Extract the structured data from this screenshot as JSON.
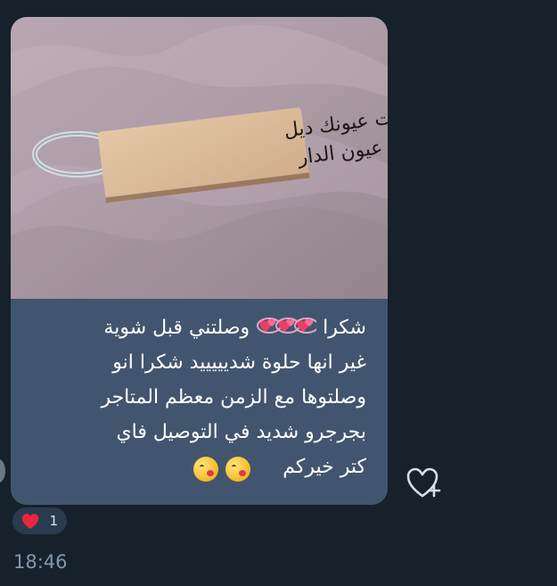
{
  "message": {
    "photo_text": {
      "line_1": "ولما لقيت عيونك ديل",
      "line_2": "بديت أنعشو عيون الدار"
    },
    "lines": [
      "شكرا💞💞💞 وصلتني قبل شوية",
      "غير انها حلوة شديييييد شكرا انو",
      "وصلتوها مع الزمن معظم المتاجر",
      "بجرجرو شديد في التوصيل فاي",
      "كتر خيركم 😘😘"
    ],
    "line_1_main": "شكرا",
    "line_1_rest": " وصلتني قبل شوية",
    "line_5_text": "كتر خيركم"
  },
  "reaction": {
    "emoji": "❤️",
    "count": "1"
  },
  "timestamp": "18:46",
  "icons": {
    "share": "heart-plus-icon",
    "reaction": "heart-icon",
    "emoji": "kiss-emoji-icon"
  },
  "colors": {
    "background": "#17212b",
    "bubble": "#41566e",
    "reaction_chip": "#2b3b4f",
    "time": "#8497aa"
  }
}
